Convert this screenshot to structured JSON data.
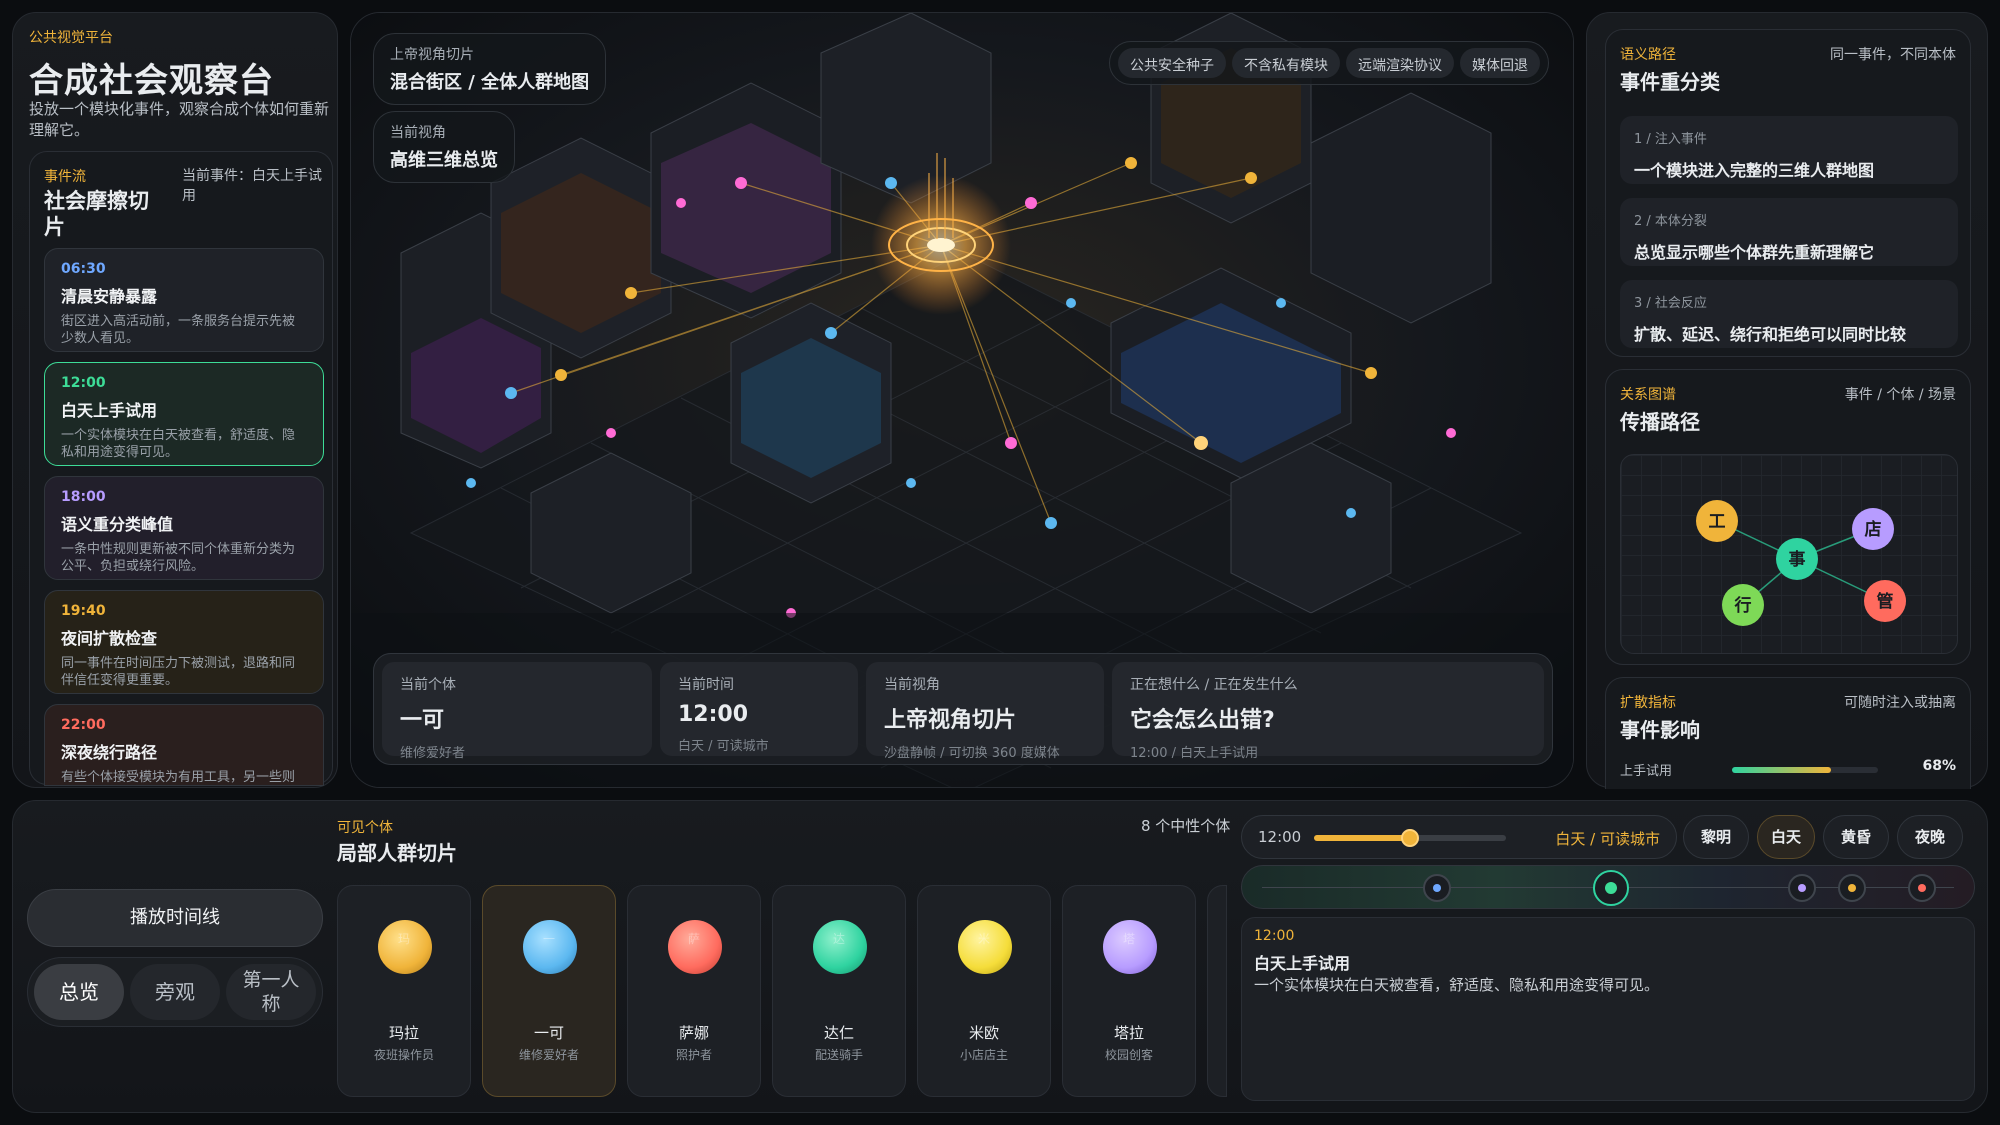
{
  "left": {
    "eyebrow": "公共视觉平台",
    "title": "合成社会观察台",
    "desc": "投放一个模块化事件，观察合成个体如何重新理解它。",
    "flow": {
      "eyebrow": "事件流",
      "title": "社会摩擦切片",
      "current": "当前事件：白天上手试用",
      "events": [
        {
          "time": "06:30",
          "title": "清晨安静暴露",
          "desc": "街区进入高活动前，一条服务台提示先被少数人看见。",
          "accent": "#6fa8ff"
        },
        {
          "time": "12:00",
          "title": "白天上手试用",
          "desc": "一个实体模块在白天被查看，舒适度、隐私和用途变得可见。",
          "accent": "#3ddc97"
        },
        {
          "time": "18:00",
          "title": "语义重分类峰值",
          "desc": "一条中性规则更新被不同个体重新分类为公平、负担或绕行风险。",
          "accent": "#b79cff"
        },
        {
          "time": "19:40",
          "title": "夜间扩散检查",
          "desc": "同一事件在时间压力下被测试，退路和同伴信任变得更重要。",
          "accent": "#f0b43a"
        },
        {
          "time": "22:00",
          "title": "深夜绕行路径",
          "desc": "有些个体接受模块为有用工具，另一些则绕行或等待更清楚的证明。",
          "accent": "#ff6b5e"
        }
      ]
    }
  },
  "map": {
    "slice_label": "上帝视角切片",
    "slice_value": "混合街区 / 全体人群地图",
    "view_label": "当前视角",
    "view_value": "高维三维总览",
    "chips": [
      "公共安全种子",
      "不含私有模块",
      "远端渲染协议",
      "媒体回退"
    ],
    "status": [
      {
        "k": "当前个体",
        "v": "一可",
        "s": "维修爱好者"
      },
      {
        "k": "当前时间",
        "v": "12:00",
        "s": "白天 / 可读城市"
      },
      {
        "k": "当前视角",
        "v": "上帝视角切片",
        "s": "沙盘静帧 / 可切换 360 度媒体"
      },
      {
        "k": "正在想什么 / 正在发生什么",
        "v": "它会怎么出错?",
        "s": "12:00 / 白天上手试用"
      }
    ]
  },
  "right": {
    "semantic": {
      "eyebrow": "语义路径",
      "aside": "同一事件，不同本体",
      "title": "事件重分类",
      "steps": [
        {
          "k": "1 / 注入事件",
          "v": "一个模块进入完整的三维人群地图"
        },
        {
          "k": "2 / 本体分裂",
          "v": "总览显示哪些个体群先重新理解它"
        },
        {
          "k": "3 / 社会反应",
          "v": "扩散、延迟、绕行和拒绝可以同时比较"
        }
      ]
    },
    "graph": {
      "eyebrow": "关系图谱",
      "aside": "事件 / 个体 / 场景",
      "title": "传播路径",
      "nodes": [
        {
          "label": "工",
          "color": "#f0b43a"
        },
        {
          "label": "店",
          "color": "#b79cff"
        },
        {
          "label": "事",
          "color": "#2fd3a0"
        },
        {
          "label": "行",
          "color": "#7ed957"
        },
        {
          "label": "管",
          "color": "#ff6b5e"
        }
      ]
    },
    "impact": {
      "eyebrow": "扩散指标",
      "aside": "可随时注入或抽离",
      "title": "事件影响",
      "metric_label": "上手试用",
      "metric_value": "68%",
      "fraction": 0.68
    }
  },
  "bottom": {
    "play_label": "播放时间线",
    "views": [
      "总览",
      "旁观",
      "第一人称"
    ],
    "active_view": 0,
    "crowd": {
      "eyebrow": "可见个体",
      "title": "局部人群切片",
      "count": "8 个中性个体",
      "people": [
        {
          "name": "玛拉",
          "role": "夜班操作员",
          "glyph": "玛",
          "color": "#f0b43a"
        },
        {
          "name": "一可",
          "role": "维修爱好者",
          "glyph": "一",
          "color": "#5cb8f0"
        },
        {
          "name": "萨娜",
          "role": "照护者",
          "glyph": "萨",
          "color": "#ff6b5e"
        },
        {
          "name": "达仁",
          "role": "配送骑手",
          "glyph": "达",
          "color": "#2fd3a0"
        },
        {
          "name": "米欧",
          "role": "小店店主",
          "glyph": "米",
          "color": "#f5dd3a"
        },
        {
          "name": "塔拉",
          "role": "校园创客",
          "glyph": "塔",
          "color": "#b79cff"
        }
      ],
      "selected": 1
    },
    "time": {
      "value": "12:00",
      "fraction": 0.5,
      "phase_text": "白天 / 可读城市",
      "phases": [
        "黎明",
        "白天",
        "黄昏",
        "夜晚"
      ],
      "active_phase": 1
    },
    "track_markers": [
      {
        "color": "#6fa8ff"
      },
      {
        "color": "#3ddc97"
      },
      {
        "color": "#b79cff"
      },
      {
        "color": "#f0b43a"
      },
      {
        "color": "#ff6b5e"
      }
    ],
    "detail": {
      "time": "12:00",
      "title": "白天上手试用",
      "desc": "一个实体模块在白天被查看，舒适度、隐私和用途变得可见。"
    }
  }
}
